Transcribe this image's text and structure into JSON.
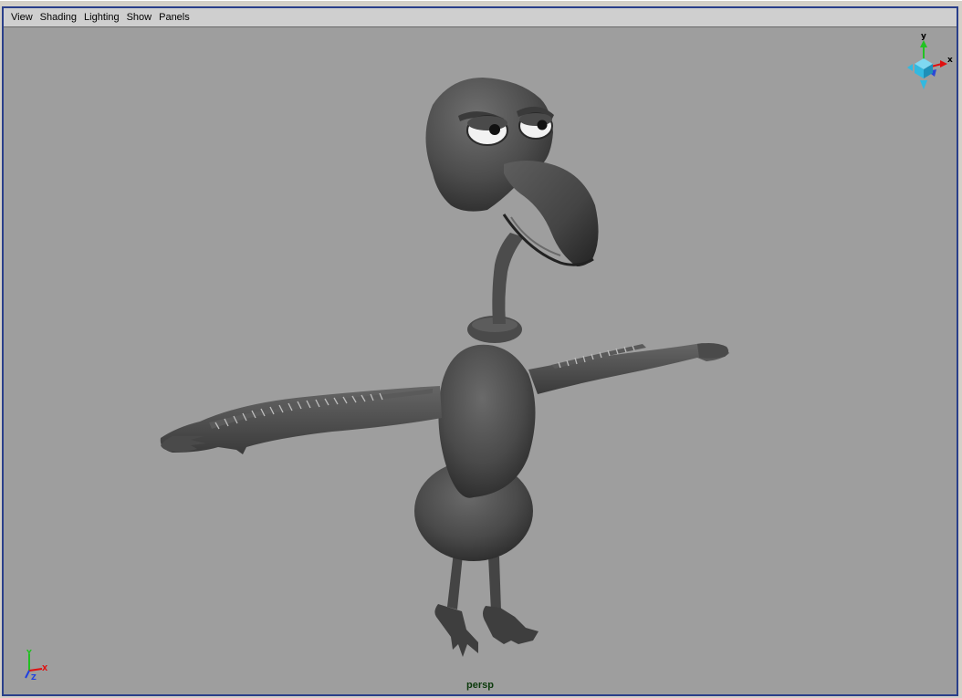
{
  "menubar": {
    "items": [
      {
        "id": "view",
        "label": "View"
      },
      {
        "id": "shading",
        "label": "Shading"
      },
      {
        "id": "lighting",
        "label": "Lighting"
      },
      {
        "id": "show",
        "label": "Show"
      },
      {
        "id": "panels",
        "label": "Panels"
      }
    ]
  },
  "viewport": {
    "camera_label": "persp",
    "background_color": "#9e9e9e",
    "model_color": "#4a4a4a"
  },
  "view_cube": {
    "labels": {
      "y": "y",
      "x": "x"
    },
    "colors": {
      "y": "#22c322",
      "x": "#e01010",
      "z": "#2a48d6",
      "cube": "#32b9e0"
    }
  },
  "axis_indicator": {
    "labels": {
      "y": "Y",
      "x": "X",
      "z": "Z"
    },
    "colors": {
      "y": "#20c020",
      "x": "#e01010",
      "z": "#2040e0"
    }
  }
}
